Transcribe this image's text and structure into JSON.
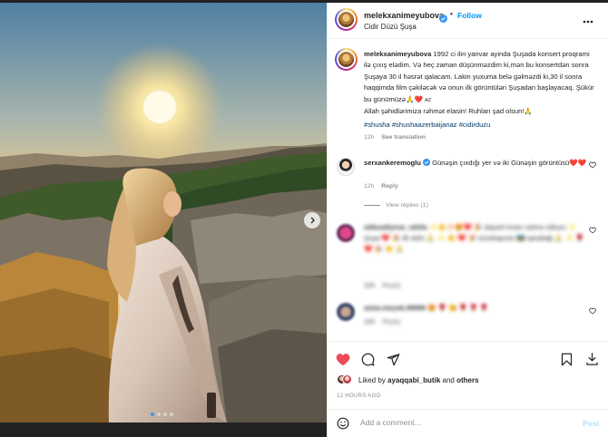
{
  "photo": {
    "nav_arrow": "chevron-right-icon",
    "carousel": {
      "count": 4,
      "active": 1
    }
  },
  "header": {
    "username": "melekxanimeyubova",
    "verified": true,
    "separator": "•",
    "follow_label": "Follow",
    "location": "Cidir Düzü Şuşa",
    "more_icon": "more-horizontal-icon"
  },
  "caption": {
    "username": "melekxanimeyubova",
    "text": "1992 ci ilin yanvar ayinda Şuşada konsert proqrami ilə çıxış elədim. Və heç zaman düşünməzdim ki,mən bu konsertdən sonra Şuşaya 30 il həsrət qalacam. Lakin yuxuma belə gəlməzdi ki,30 il sonra haqqimda film çəkiləcək və onun ilk görüntüləri Şuşadan başlayacaq. Şükür bu günümüzə🙏❤️",
    "text_tail": "Allah şəhidlərimiza rəhmət elasin! Ruhları şad olsun!🙏",
    "flag_text": "AZ",
    "hashtags": "#shusha #shushaazerbaijanaz #cidirduzu",
    "time": "12h",
    "see_translation": "See translation"
  },
  "comments": [
    {
      "username": "serxankeremoglu",
      "verified": true,
      "text": "Günəşin çıxdığı yer və iki Günəşin görüntüsü❤️❤️",
      "time": "12h",
      "reply": "Reply",
      "view_replies": "View replies (1)"
    },
    {
      "username": "ulduzaliyeva_rahila",
      "text": "✨👏👏🏻😍❤️ 🎉 dəyərli insan səhnə ulduzu ✨ Şuşa ❤️ 🎉 ilk dəfə 🙏 ✨ 👏 ❤️ 🎉 Azərbaycan 🇦🇿 qarabağ 🙏 ✨ 🌹 ❤️ 🎉 👏 🙏",
      "time": "11h",
      "reply": "Reply",
      "blurred": true
    },
    {
      "username": "aziza.meyob.99999",
      "text": "😍 🌹 😘 🌹 🌹 🌹",
      "time": "11h",
      "reply": "Reply",
      "blurred": true
    }
  ],
  "actions": {
    "like_icon": "heart-filled-icon",
    "comment_icon": "comment-icon",
    "share_icon": "send-icon",
    "save_icon": "bookmark-icon",
    "download_icon": "download-icon",
    "liked_prefix": "Liked by",
    "liked_user": "ayaqqabi_butik",
    "liked_suffix": "and",
    "liked_others": "others",
    "time_ago": "12 HOURS AGO"
  },
  "add_comment": {
    "placeholder": "Add a comment...",
    "post_label": "Post",
    "emoji_icon": "smile-icon"
  },
  "colors": {
    "accent": "#0095f6",
    "like": "#ed4956",
    "text": "#262626",
    "muted": "#8e8e8e",
    "link": "#00376b"
  }
}
